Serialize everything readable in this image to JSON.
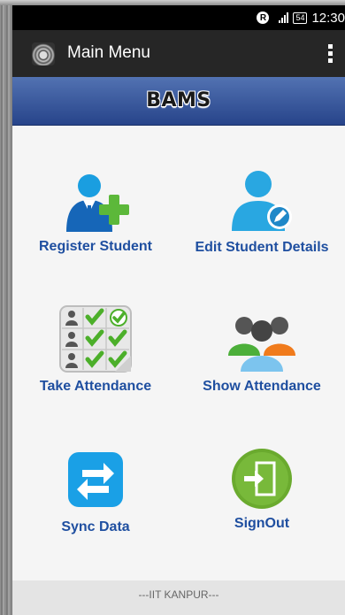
{
  "status_bar": {
    "r_badge": "R",
    "battery": "54",
    "time": "12:30"
  },
  "app_bar": {
    "title": "Main Menu"
  },
  "header": {
    "title": "BAMS"
  },
  "menu": {
    "register_student": "Register Student",
    "edit_student_details": "Edit Student Details",
    "take_attendance": "Take Attendance",
    "show_attendance": "Show Attendance",
    "sync_data": "Sync Data",
    "sign_out": "SignOut"
  },
  "footer": {
    "text": "---IIT KANPUR---"
  },
  "colors": {
    "app_bar": "#262626",
    "header_gradient_top": "#5272b2",
    "header_gradient_bottom": "#27448a",
    "menu_label": "#1f4fa0",
    "background": "#f5f5f5",
    "footer": "#e4e4e4"
  },
  "icons": {
    "register_student": "person-add-icon",
    "edit_student_details": "person-edit-icon",
    "take_attendance": "attendance-checklist-icon",
    "show_attendance": "group-people-icon",
    "sync_data": "sync-arrows-icon",
    "sign_out": "sign-out-icon"
  }
}
